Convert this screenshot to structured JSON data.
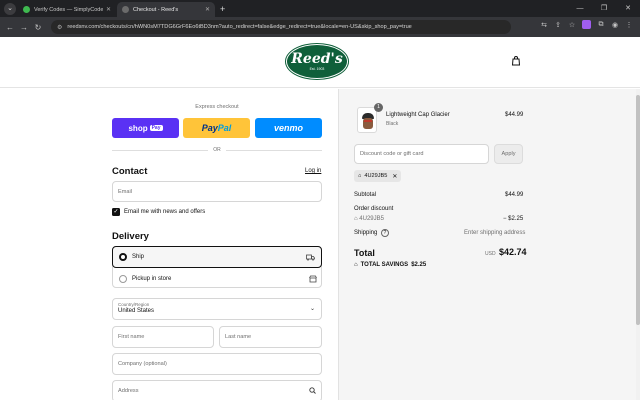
{
  "browser": {
    "tabs": [
      {
        "title": "Verify Codes — SimplyCodes",
        "active": false,
        "favicon_color": "#3fb950"
      },
      {
        "title": "Checkout - Reed's",
        "active": true,
        "favicon_color": "#6b6b6b"
      }
    ],
    "url": "reedsnv.com/checkouts/cn/hWN0sM7TDG6GrF6Eo6tBD3nm?auto_redirect=false&edge_redirect=true&locale=en-US&skip_shop_pay=true"
  },
  "header": {
    "logo_text": "Reed's",
    "logo_est": "Est. 1903"
  },
  "express": {
    "label": "Express checkout",
    "shoppay": "shop",
    "shoppay_badge": "Pay",
    "paypal_a": "Pay",
    "paypal_b": "Pal",
    "venmo": "venmo",
    "or": "OR"
  },
  "contact": {
    "heading": "Contact",
    "login": "Log in",
    "email_placeholder": "Email",
    "news_label": "Email me with news and offers",
    "news_checked": true
  },
  "delivery": {
    "heading": "Delivery",
    "options": [
      {
        "label": "Ship",
        "selected": true
      },
      {
        "label": "Pickup in store",
        "selected": false
      }
    ],
    "country_label": "Country/Region",
    "country_value": "United States",
    "first_name": "First name",
    "last_name": "Last name",
    "company": "Company (optional)",
    "address": "Address"
  },
  "summary": {
    "item": {
      "name": "Lightweight Cap Glacier",
      "variant": "Black",
      "price": "$44.99",
      "qty": "1"
    },
    "discount_placeholder": "Discount code or gift card",
    "apply": "Apply",
    "applied_code": "4U29JB5",
    "subtotal_label": "Subtotal",
    "subtotal": "$44.99",
    "order_discount_label": "Order discount",
    "discount_code": "4U29JB5",
    "discount_amount": "− $2.25",
    "shipping_label": "Shipping",
    "shipping_value": "Enter shipping address",
    "total_label": "Total",
    "currency": "USD",
    "total": "$42.74",
    "savings_label": "TOTAL SAVINGS",
    "savings_value": "$2.25"
  },
  "colors": {
    "brand_green": "#0f5f3a",
    "shoppay": "#5a31f4",
    "paypal": "#ffc439",
    "venmo": "#008cff"
  }
}
